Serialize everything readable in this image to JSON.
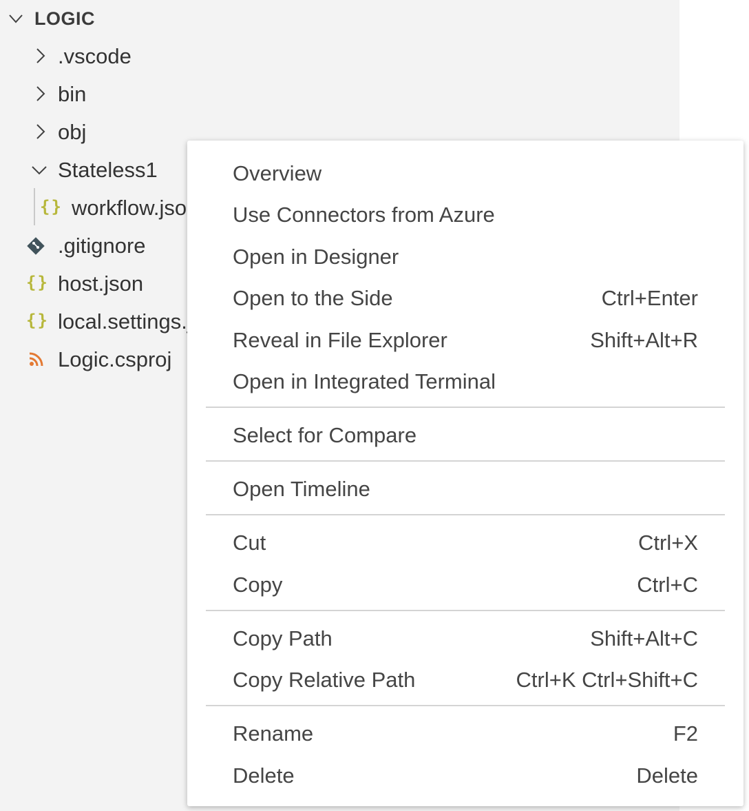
{
  "explorer": {
    "section_title": "LOGIC",
    "items": [
      {
        "label": ".vscode",
        "icon": "chevron-right-icon"
      },
      {
        "label": "bin",
        "icon": "chevron-right-icon"
      },
      {
        "label": "obj",
        "icon": "chevron-right-icon"
      },
      {
        "label": "Stateless1",
        "icon": "chevron-down-icon"
      },
      {
        "label": "workflow.json",
        "icon": "json-file-icon",
        "glyph": "{}"
      },
      {
        "label": ".gitignore",
        "icon": "git-file-icon"
      },
      {
        "label": "host.json",
        "icon": "json-file-icon",
        "glyph": "{}"
      },
      {
        "label": "local.settings.json",
        "icon": "json-file-icon",
        "glyph": "{}"
      },
      {
        "label": "Logic.csproj",
        "icon": "rss-file-icon"
      }
    ]
  },
  "context_menu": {
    "items": [
      {
        "label": "Overview",
        "shortcut": ""
      },
      {
        "label": "Use Connectors from Azure",
        "shortcut": ""
      },
      {
        "label": "Open in Designer",
        "shortcut": ""
      },
      {
        "label": "Open to the Side",
        "shortcut": "Ctrl+Enter"
      },
      {
        "label": "Reveal in File Explorer",
        "shortcut": "Shift+Alt+R"
      },
      {
        "label": "Open in Integrated Terminal",
        "shortcut": ""
      },
      {
        "label": "Select for Compare",
        "shortcut": ""
      },
      {
        "label": "Open Timeline",
        "shortcut": ""
      },
      {
        "label": "Cut",
        "shortcut": "Ctrl+X"
      },
      {
        "label": "Copy",
        "shortcut": "Ctrl+C"
      },
      {
        "label": "Copy Path",
        "shortcut": "Shift+Alt+C"
      },
      {
        "label": "Copy Relative Path",
        "shortcut": "Ctrl+K Ctrl+Shift+C"
      },
      {
        "label": "Rename",
        "shortcut": "F2"
      },
      {
        "label": "Delete",
        "shortcut": "Delete"
      }
    ]
  },
  "colors": {
    "sidebar_bg": "#f3f3f3",
    "json_icon": "#b7b73b",
    "rss_icon": "#e37933",
    "git_icon": "#41535b",
    "menu_text": "#454545"
  }
}
